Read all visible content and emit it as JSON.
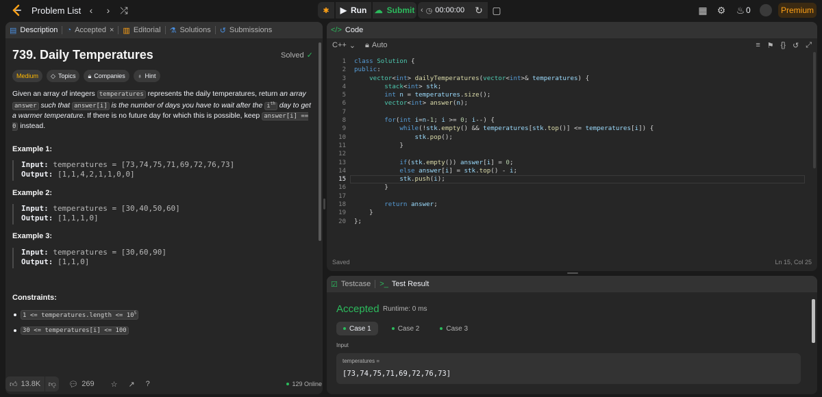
{
  "nav": {
    "title": "Problem List",
    "run": "Run",
    "submit": "Submit",
    "timer": "00:00:00",
    "streak": "0",
    "premium": "Premium"
  },
  "left_tabs": {
    "description": "Description",
    "accepted": "Accepted",
    "editorial": "Editorial",
    "solutions": "Solutions",
    "submissions": "Submissions"
  },
  "problem": {
    "title": "739. Daily Temperatures",
    "solved": "Solved",
    "chips": {
      "difficulty": "Medium",
      "topics": "Topics",
      "companies": "Companies",
      "hint": "Hint"
    },
    "desc": {
      "p1": "Given an array of integers ",
      "c1": "temperatures",
      "p2": " represents the daily temperatures, return ",
      "i1": "an array",
      "c2": "answer",
      "i2": "such that",
      "c3": "answer[i]",
      "i3": " is the number of days you have to wait after the ",
      "c4": "i",
      "c4sup": "th",
      "i4": " day to get a warmer temperature",
      "p3": ". If there is no future day for which this is possible, keep ",
      "c5": "answer[i] == 0",
      "p4": " instead."
    },
    "examples": [
      {
        "title": "Example 1:",
        "input_label": "Input:",
        "input": "temperatures = [73,74,75,71,69,72,76,73]",
        "output_label": "Output:",
        "output": "[1,1,4,2,1,1,0,0]"
      },
      {
        "title": "Example 2:",
        "input_label": "Input:",
        "input": "temperatures = [30,40,50,60]",
        "output_label": "Output:",
        "output": "[1,1,1,0]"
      },
      {
        "title": "Example 3:",
        "input_label": "Input:",
        "input": "temperatures = [30,60,90]",
        "output_label": "Output:",
        "output": "[1,1,0]"
      }
    ],
    "constraints_title": "Constraints:",
    "constraints": [
      {
        "text": "1 <= temperatures.length <= 10",
        "sup": "5"
      },
      {
        "text": "30 <= temperatures[i] <= 100",
        "sup": ""
      }
    ],
    "footer": {
      "likes": "13.8K",
      "comments": "269",
      "online": "129 Online"
    }
  },
  "code_panel": {
    "title": "Code",
    "language": "C++",
    "mode": "Auto",
    "saved": "Saved",
    "cursor": "Ln 15, Col 25",
    "line_numbers": [
      "1",
      "2",
      "3",
      "4",
      "5",
      "6",
      "7",
      "8",
      "9",
      "10",
      "11",
      "12",
      "13",
      "14",
      "15",
      "16",
      "17",
      "18",
      "19",
      "20"
    ]
  },
  "result_panel": {
    "testcase_tab": "Testcase",
    "result_tab": "Test Result",
    "status": "Accepted",
    "runtime": "Runtime: 0 ms",
    "cases": [
      "Case 1",
      "Case 2",
      "Case 3"
    ],
    "input_label": "Input",
    "var_name": "temperatures =",
    "var_value": "[73,74,75,71,69,72,76,73]"
  },
  "colors": {
    "accent": "#ffa116",
    "accepted": "#2cbb5d",
    "medium": "#ffb800",
    "panel": "#262626",
    "bg": "#1a1a1a"
  }
}
